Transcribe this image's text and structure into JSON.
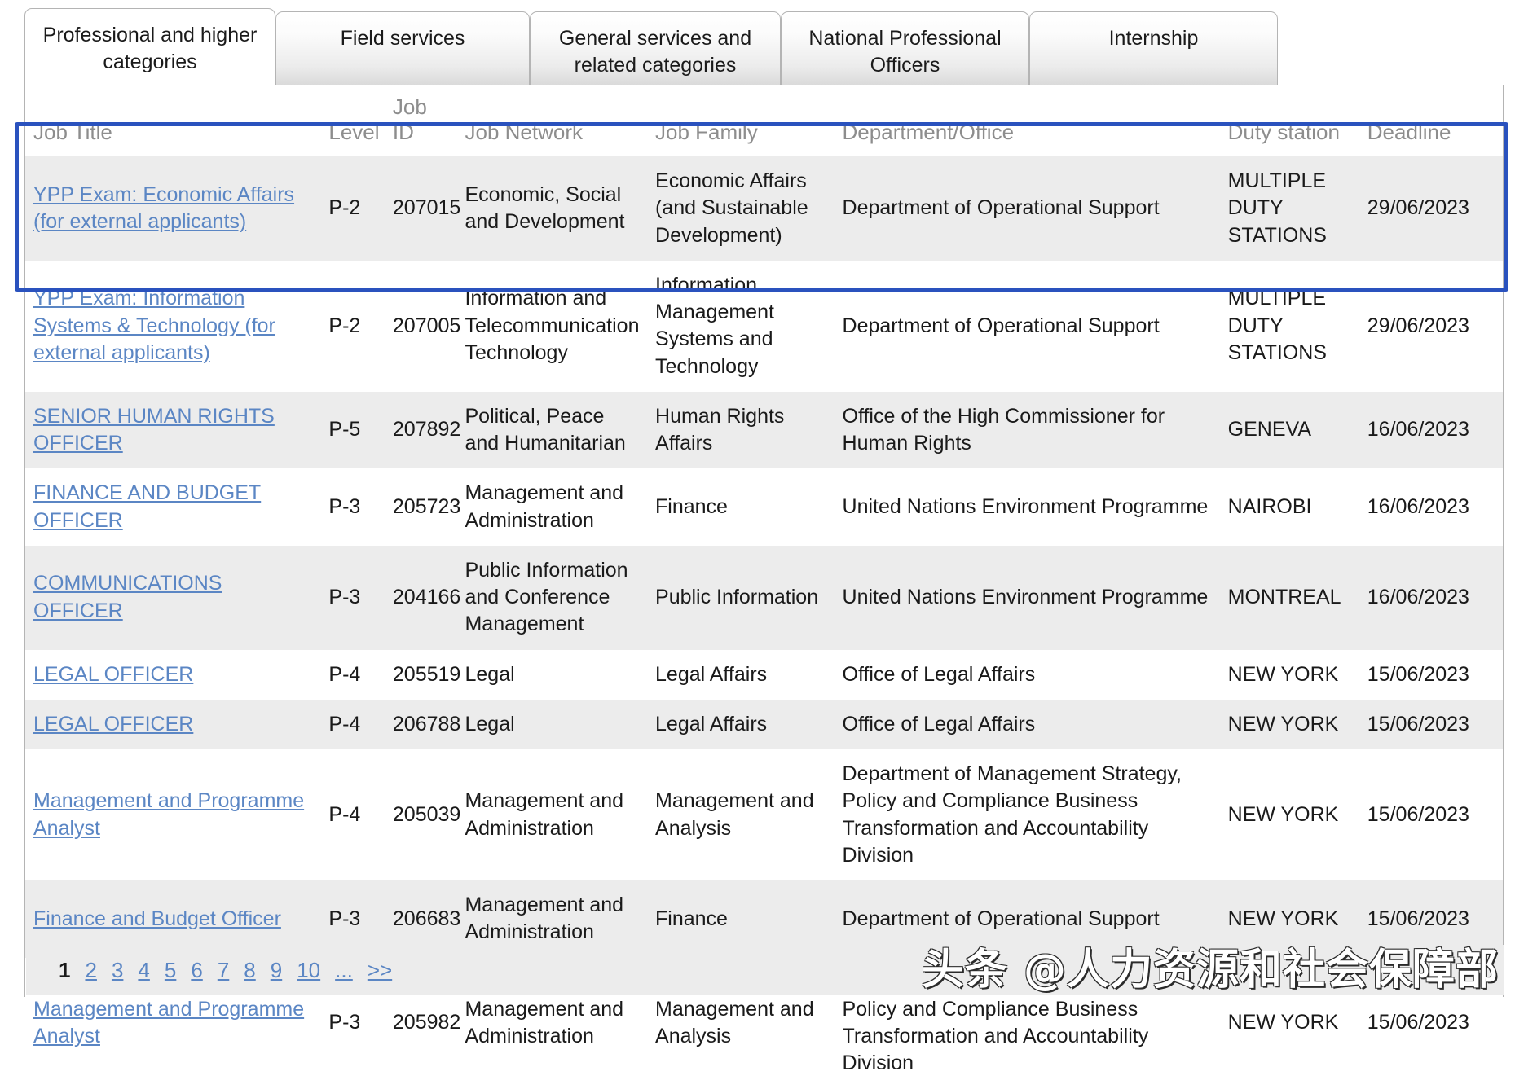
{
  "tabs": [
    {
      "label": "Professional and higher categories",
      "active": true
    },
    {
      "label": "Field services",
      "active": false
    },
    {
      "label": "General services and related categories",
      "active": false
    },
    {
      "label": "National Professional Officers",
      "active": false
    },
    {
      "label": "Internship",
      "active": false
    }
  ],
  "table": {
    "columns": [
      "Job Title",
      "Level",
      "Job ID",
      "Job Network",
      "Job Family",
      "Department/Office",
      "Duty station",
      "Deadline"
    ],
    "rows": [
      {
        "title": "YPP Exam: Economic Affairs (for external applicants)",
        "level": "P-2",
        "job_id": "207015",
        "network": "Economic, Social and Development",
        "family": "Economic Affairs (and Sustainable Development)",
        "department": "Department of Operational Support",
        "duty_station": "MULTIPLE DUTY STATIONS",
        "deadline": "29/06/2023"
      },
      {
        "title": "YPP Exam: Information Systems & Technology (for external applicants)",
        "level": "P-2",
        "job_id": "207005",
        "network": "Information and Telecommunication Technology",
        "family": "Information Management Systems and Technology",
        "department": "Department of Operational Support",
        "duty_station": "MULTIPLE DUTY STATIONS",
        "deadline": "29/06/2023"
      },
      {
        "title": "SENIOR HUMAN RIGHTS OFFICER",
        "level": "P-5",
        "job_id": "207892",
        "network": "Political, Peace and Humanitarian",
        "family": "Human Rights Affairs",
        "department": "Office of the High Commissioner for Human Rights",
        "duty_station": "GENEVA",
        "deadline": "16/06/2023"
      },
      {
        "title": "FINANCE AND BUDGET OFFICER",
        "level": "P-3",
        "job_id": "205723",
        "network": "Management and Administration",
        "family": "Finance",
        "department": "United Nations Environment Programme",
        "duty_station": "NAIROBI",
        "deadline": "16/06/2023"
      },
      {
        "title": "COMMUNICATIONS OFFICER",
        "level": "P-3",
        "job_id": "204166",
        "network": "Public Information and Conference Management",
        "family": "Public Information",
        "department": "United Nations Environment Programme",
        "duty_station": "MONTREAL",
        "deadline": "16/06/2023"
      },
      {
        "title": "LEGAL OFFICER",
        "level": "P-4",
        "job_id": "205519",
        "network": "Legal",
        "family": "Legal Affairs",
        "department": "Office of Legal Affairs",
        "duty_station": "NEW YORK",
        "deadline": "15/06/2023"
      },
      {
        "title": "LEGAL OFFICER",
        "level": "P-4",
        "job_id": "206788",
        "network": "Legal",
        "family": "Legal Affairs",
        "department": "Office of Legal Affairs",
        "duty_station": "NEW YORK",
        "deadline": "15/06/2023"
      },
      {
        "title": "Management and Programme Analyst",
        "level": "P-4",
        "job_id": "205039",
        "network": "Management and Administration",
        "family": "Management and Analysis",
        "department": "Department of Management Strategy, Policy and Compliance Business Transformation and Accountability Division",
        "duty_station": "NEW YORK",
        "deadline": "15/06/2023"
      },
      {
        "title": "Finance and Budget Officer",
        "level": "P-3",
        "job_id": "206683",
        "network": "Management and Administration",
        "family": "Finance",
        "department": "Department of Operational Support",
        "duty_station": "NEW YORK",
        "deadline": "15/06/2023"
      },
      {
        "title": "Management and Programme Analyst",
        "level": "P-3",
        "job_id": "205982",
        "network": "Management and Administration",
        "family": "Management and Analysis",
        "department": "Department of Management Strategy, Policy and Compliance Business Transformation and Accountability Division",
        "duty_station": "NEW YORK",
        "deadline": "15/06/2023"
      }
    ]
  },
  "pagination": {
    "current": "1",
    "pages": [
      "2",
      "3",
      "4",
      "5",
      "6",
      "7",
      "8",
      "9",
      "10"
    ],
    "ellipsis": "...",
    "next": ">>"
  },
  "watermark": {
    "text": "头条 @人力资源和社会保障部"
  },
  "colors": {
    "link": "#5b86c4",
    "highlight": "#2a52be",
    "alt_row": "#ececec",
    "header_text": "#8d8d8d"
  }
}
